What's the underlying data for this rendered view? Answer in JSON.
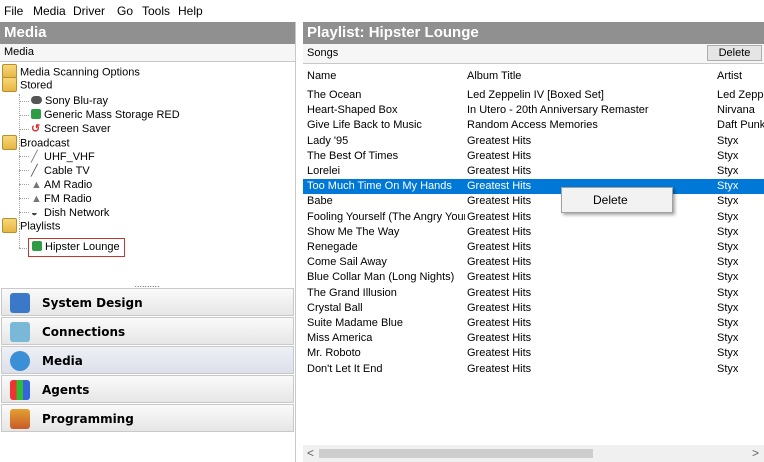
{
  "menu": [
    "File",
    "Media",
    "Driver",
    "Go",
    "Tools",
    "Help"
  ],
  "left": {
    "title": "Media",
    "subheader": "Media",
    "tree": {
      "scanning": "Media Scanning Options",
      "stored": "Stored",
      "stored_items": [
        "Sony Blu-ray",
        "Generic Mass Storage RED",
        "Screen Saver"
      ],
      "broadcast": "Broadcast",
      "broadcast_items": [
        "UHF_VHF",
        "Cable TV",
        "AM Radio",
        "FM Radio",
        "Dish Network"
      ],
      "playlists": "Playlists",
      "playlist_items": [
        "Hipster Lounge"
      ]
    },
    "splitter": "..........",
    "nav": [
      "System Design",
      "Connections",
      "Media",
      "Agents",
      "Programming"
    ]
  },
  "right": {
    "title": "Playlist: Hipster Lounge",
    "songs_label": "Songs",
    "delete_label": "Delete",
    "columns": [
      "Name",
      "Album Title",
      "Artist"
    ],
    "rows": [
      [
        "The Ocean",
        "Led Zeppelin IV [Boxed Set]",
        "Led Zeppe"
      ],
      [
        "Heart-Shaped Box",
        "In Utero - 20th Anniversary Remaster",
        "Nirvana"
      ],
      [
        "Give Life Back to Music",
        "Random Access Memories",
        "Daft Punk"
      ],
      [
        "Lady '95",
        "Greatest Hits",
        "Styx"
      ],
      [
        "The Best Of Times",
        "Greatest Hits",
        "Styx"
      ],
      [
        "Lorelei",
        "Greatest Hits",
        "Styx"
      ],
      [
        "Too Much Time On My Hands",
        "Greatest Hits",
        "Styx"
      ],
      [
        "Babe",
        "Greatest Hits",
        "Styx"
      ],
      [
        "Fooling Yourself (The Angry Youn...",
        "Greatest Hits",
        "Styx"
      ],
      [
        "Show Me The Way",
        "Greatest Hits",
        "Styx"
      ],
      [
        "Renegade",
        "Greatest Hits",
        "Styx"
      ],
      [
        "Come Sail Away",
        "Greatest Hits",
        "Styx"
      ],
      [
        "Blue Collar Man (Long Nights)",
        "Greatest Hits",
        "Styx"
      ],
      [
        "The Grand Illusion",
        "Greatest Hits",
        "Styx"
      ],
      [
        "Crystal Ball",
        "Greatest Hits",
        "Styx"
      ],
      [
        "Suite Madame Blue",
        "Greatest Hits",
        "Styx"
      ],
      [
        "Miss America",
        "Greatest Hits",
        "Styx"
      ],
      [
        "Mr. Roboto",
        "Greatest Hits",
        "Styx"
      ],
      [
        "Don't Let It End",
        "Greatest Hits",
        "Styx"
      ]
    ],
    "selected_row": "Too Much Time On My Hands",
    "context_menu": [
      "Delete"
    ]
  },
  "colors": {
    "header": "#909090",
    "selection": "#0078d7",
    "highlight_border": "#c0392b"
  }
}
